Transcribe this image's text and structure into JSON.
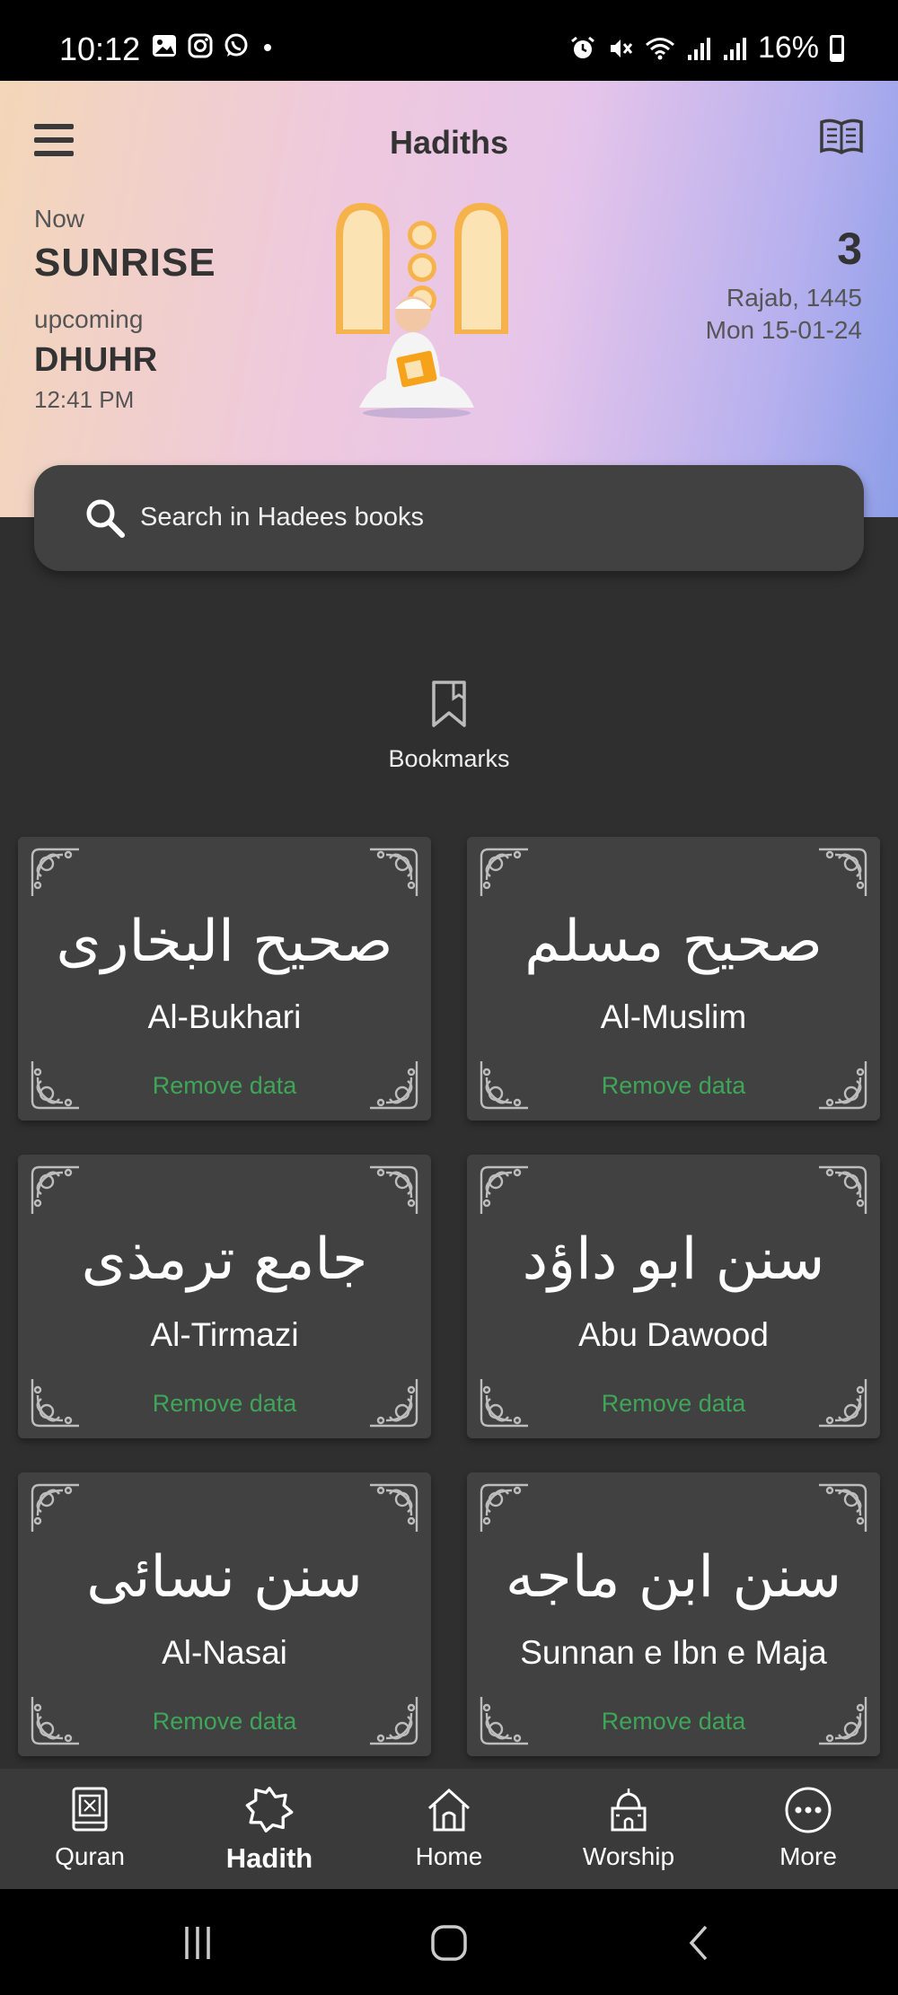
{
  "status_bar": {
    "time": "10:12",
    "battery": "16%",
    "left_icons": [
      "gallery-icon",
      "instagram-icon",
      "whatsapp-icon",
      "dot-icon"
    ],
    "right_icons": [
      "alarm-icon",
      "mute-icon",
      "wifi-icon",
      "signal-icon",
      "signal-icon",
      "battery-icon"
    ]
  },
  "header": {
    "title": "Hadiths",
    "menu_icon": "hamburger-menu-icon",
    "book_icon": "open-book-icon",
    "prayer": {
      "now_label": "Now",
      "now_name": "SUNRISE",
      "upcoming_label": "upcoming",
      "upcoming_name": "DHUHR",
      "upcoming_time": "12:41 PM"
    },
    "date": {
      "day": "3",
      "hijri": "Rajab, 1445",
      "gregorian": "Mon 15-01-24"
    }
  },
  "search": {
    "placeholder": "Search in Hadees books"
  },
  "bookmarks": {
    "label": "Bookmarks"
  },
  "books": [
    {
      "arabic": "صحیح البخاری",
      "name": "Al-Bukhari",
      "action": "Remove data"
    },
    {
      "arabic": "صحیح مسلم",
      "name": "Al-Muslim",
      "action": "Remove data"
    },
    {
      "arabic": "جامع ترمذی",
      "name": "Al-Tirmazi",
      "action": "Remove data"
    },
    {
      "arabic": "سنن ابو داؤد",
      "name": "Abu Dawood",
      "action": "Remove data"
    },
    {
      "arabic": "سنن نسائی",
      "name": "Al-Nasai",
      "action": "Remove data"
    },
    {
      "arabic": "سنن ابن ماجه",
      "name": "Sunnan e Ibn e Maja",
      "action": "Remove data"
    }
  ],
  "bottom_nav": {
    "items": [
      {
        "label": "Quran",
        "icon": "quran-book-icon"
      },
      {
        "label": "Hadith",
        "icon": "octagon-star-icon",
        "active": true
      },
      {
        "label": "Home",
        "icon": "house-icon"
      },
      {
        "label": "Worship",
        "icon": "mosque-icon"
      },
      {
        "label": "More",
        "icon": "more-dots-icon"
      }
    ]
  },
  "colors": {
    "accent_green": "#3fa558",
    "card_bg": "#414141",
    "page_bg": "#2f2f2f"
  }
}
